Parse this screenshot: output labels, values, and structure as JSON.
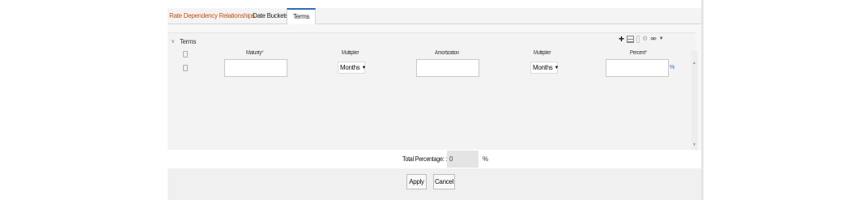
{
  "tabs": {
    "rate_dependency": "Rate Dependency Relationships",
    "date_buckets": "Date Buckets",
    "terms": "Terms"
  },
  "section": {
    "title": "Terms",
    "toolbar_icons": [
      "add-icon",
      "grid-icon",
      "separator",
      "settings-icon",
      "filter-icon",
      "dropdown-icon"
    ]
  },
  "table": {
    "columns": {
      "maturity": "Maturity",
      "multiplier1": "Multiplier",
      "amortization": "Amortization",
      "multiplier2": "Multiplier",
      "percent": "Percent"
    },
    "required_mark": "*",
    "rows": [
      {
        "maturity": "",
        "multiplier1": "Months",
        "amortization": "",
        "multiplier2": "Months",
        "percent": "",
        "percent_suffix": "%"
      }
    ]
  },
  "total": {
    "label": "Total Percentage: :",
    "value": "0",
    "suffix": "%"
  },
  "actions": {
    "apply": "Apply",
    "cancel": "Cancel"
  },
  "colors": {
    "accent_tab": "#2f6db5",
    "link_orange": "#c7501a",
    "required_red": "#cc2222"
  }
}
